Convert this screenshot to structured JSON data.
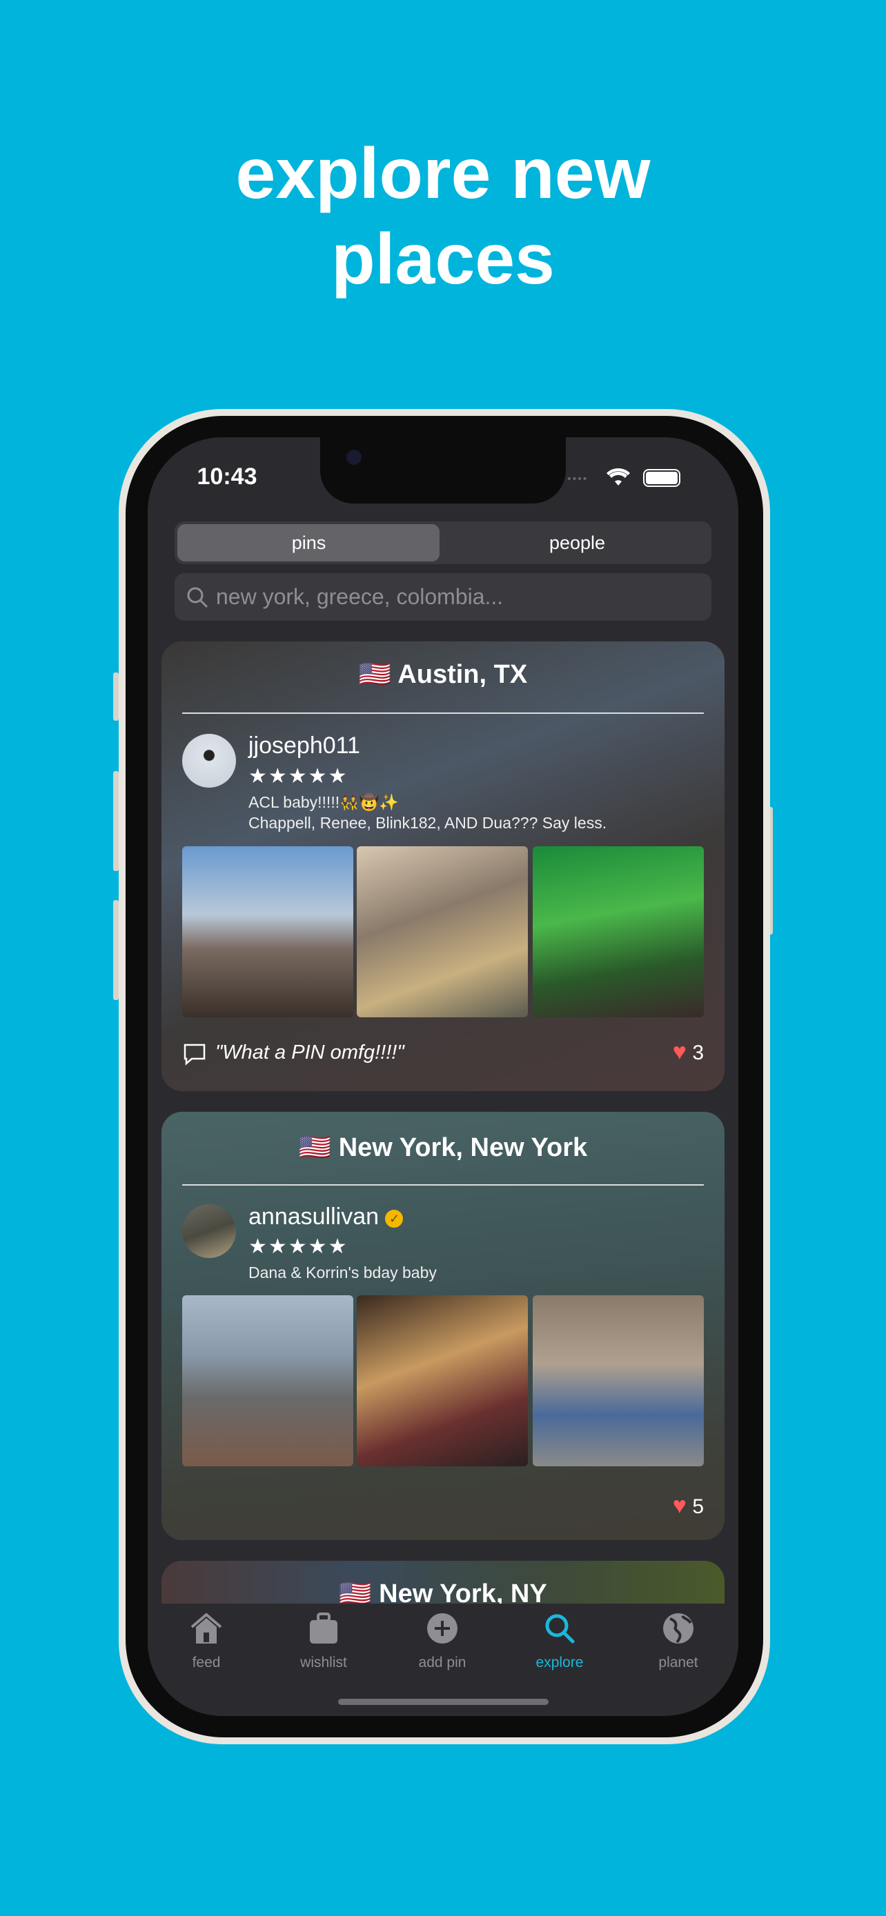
{
  "headline": {
    "line1": "explore new",
    "line2": "places"
  },
  "status_bar": {
    "time": "10:43"
  },
  "segmented": {
    "options": [
      "pins",
      "people"
    ],
    "selected": "pins"
  },
  "search": {
    "placeholder": "new york, greece, colombia..."
  },
  "cards": [
    {
      "flag": "🇺🇸",
      "location": "Austin, TX",
      "username": "jjoseph011",
      "verified": false,
      "rating": 5,
      "stars": "★★★★★",
      "caption_lines": [
        "ACL baby!!!!!👯‍♀️🤠✨",
        "Chappell, Renee, Blink182, AND Dua??? Say less."
      ],
      "comment": "\"What a PIN omfg!!!!\"",
      "likes": "3"
    },
    {
      "flag": "🇺🇸",
      "location": "New York, New York",
      "username": "annasullivan",
      "verified": true,
      "rating": 5,
      "stars": "★★★★★",
      "caption_lines": [
        "Dana & Korrin's bday baby"
      ],
      "likes": "5"
    },
    {
      "flag": "🇺🇸",
      "location": "New York, NY"
    }
  ],
  "tabbar": {
    "active": "explore",
    "items": [
      {
        "label": "feed",
        "icon": "house-icon"
      },
      {
        "label": "wishlist",
        "icon": "suitcase-icon"
      },
      {
        "label": "add pin",
        "icon": "plus-circle-icon"
      },
      {
        "label": "explore",
        "icon": "magnifier-icon"
      },
      {
        "label": "planet",
        "icon": "globe-icon"
      }
    ]
  },
  "colors": {
    "background": "#00b4dc",
    "accent": "#1ab8dc",
    "heart": "#ff5a5a",
    "verified": "#f5b800"
  }
}
